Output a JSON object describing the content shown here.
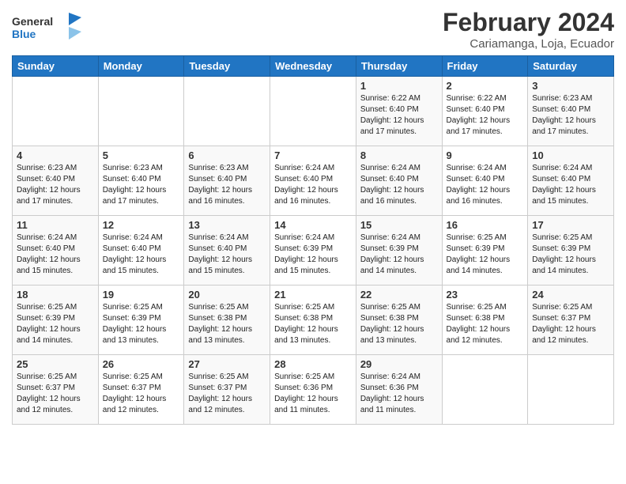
{
  "header": {
    "logo_general": "General",
    "logo_blue": "Blue",
    "title": "February 2024",
    "location": "Cariamanga, Loja, Ecuador"
  },
  "days_of_week": [
    "Sunday",
    "Monday",
    "Tuesday",
    "Wednesday",
    "Thursday",
    "Friday",
    "Saturday"
  ],
  "weeks": [
    [
      {
        "day": "",
        "info": ""
      },
      {
        "day": "",
        "info": ""
      },
      {
        "day": "",
        "info": ""
      },
      {
        "day": "",
        "info": ""
      },
      {
        "day": "1",
        "info": "Sunrise: 6:22 AM\nSunset: 6:40 PM\nDaylight: 12 hours\nand 17 minutes."
      },
      {
        "day": "2",
        "info": "Sunrise: 6:22 AM\nSunset: 6:40 PM\nDaylight: 12 hours\nand 17 minutes."
      },
      {
        "day": "3",
        "info": "Sunrise: 6:23 AM\nSunset: 6:40 PM\nDaylight: 12 hours\nand 17 minutes."
      }
    ],
    [
      {
        "day": "4",
        "info": "Sunrise: 6:23 AM\nSunset: 6:40 PM\nDaylight: 12 hours\nand 17 minutes."
      },
      {
        "day": "5",
        "info": "Sunrise: 6:23 AM\nSunset: 6:40 PM\nDaylight: 12 hours\nand 17 minutes."
      },
      {
        "day": "6",
        "info": "Sunrise: 6:23 AM\nSunset: 6:40 PM\nDaylight: 12 hours\nand 16 minutes."
      },
      {
        "day": "7",
        "info": "Sunrise: 6:24 AM\nSunset: 6:40 PM\nDaylight: 12 hours\nand 16 minutes."
      },
      {
        "day": "8",
        "info": "Sunrise: 6:24 AM\nSunset: 6:40 PM\nDaylight: 12 hours\nand 16 minutes."
      },
      {
        "day": "9",
        "info": "Sunrise: 6:24 AM\nSunset: 6:40 PM\nDaylight: 12 hours\nand 16 minutes."
      },
      {
        "day": "10",
        "info": "Sunrise: 6:24 AM\nSunset: 6:40 PM\nDaylight: 12 hours\nand 15 minutes."
      }
    ],
    [
      {
        "day": "11",
        "info": "Sunrise: 6:24 AM\nSunset: 6:40 PM\nDaylight: 12 hours\nand 15 minutes."
      },
      {
        "day": "12",
        "info": "Sunrise: 6:24 AM\nSunset: 6:40 PM\nDaylight: 12 hours\nand 15 minutes."
      },
      {
        "day": "13",
        "info": "Sunrise: 6:24 AM\nSunset: 6:40 PM\nDaylight: 12 hours\nand 15 minutes."
      },
      {
        "day": "14",
        "info": "Sunrise: 6:24 AM\nSunset: 6:39 PM\nDaylight: 12 hours\nand 15 minutes."
      },
      {
        "day": "15",
        "info": "Sunrise: 6:24 AM\nSunset: 6:39 PM\nDaylight: 12 hours\nand 14 minutes."
      },
      {
        "day": "16",
        "info": "Sunrise: 6:25 AM\nSunset: 6:39 PM\nDaylight: 12 hours\nand 14 minutes."
      },
      {
        "day": "17",
        "info": "Sunrise: 6:25 AM\nSunset: 6:39 PM\nDaylight: 12 hours\nand 14 minutes."
      }
    ],
    [
      {
        "day": "18",
        "info": "Sunrise: 6:25 AM\nSunset: 6:39 PM\nDaylight: 12 hours\nand 14 minutes."
      },
      {
        "day": "19",
        "info": "Sunrise: 6:25 AM\nSunset: 6:39 PM\nDaylight: 12 hours\nand 13 minutes."
      },
      {
        "day": "20",
        "info": "Sunrise: 6:25 AM\nSunset: 6:38 PM\nDaylight: 12 hours\nand 13 minutes."
      },
      {
        "day": "21",
        "info": "Sunrise: 6:25 AM\nSunset: 6:38 PM\nDaylight: 12 hours\nand 13 minutes."
      },
      {
        "day": "22",
        "info": "Sunrise: 6:25 AM\nSunset: 6:38 PM\nDaylight: 12 hours\nand 13 minutes."
      },
      {
        "day": "23",
        "info": "Sunrise: 6:25 AM\nSunset: 6:38 PM\nDaylight: 12 hours\nand 12 minutes."
      },
      {
        "day": "24",
        "info": "Sunrise: 6:25 AM\nSunset: 6:37 PM\nDaylight: 12 hours\nand 12 minutes."
      }
    ],
    [
      {
        "day": "25",
        "info": "Sunrise: 6:25 AM\nSunset: 6:37 PM\nDaylight: 12 hours\nand 12 minutes."
      },
      {
        "day": "26",
        "info": "Sunrise: 6:25 AM\nSunset: 6:37 PM\nDaylight: 12 hours\nand 12 minutes."
      },
      {
        "day": "27",
        "info": "Sunrise: 6:25 AM\nSunset: 6:37 PM\nDaylight: 12 hours\nand 12 minutes."
      },
      {
        "day": "28",
        "info": "Sunrise: 6:25 AM\nSunset: 6:36 PM\nDaylight: 12 hours\nand 11 minutes."
      },
      {
        "day": "29",
        "info": "Sunrise: 6:24 AM\nSunset: 6:36 PM\nDaylight: 12 hours\nand 11 minutes."
      },
      {
        "day": "",
        "info": ""
      },
      {
        "day": "",
        "info": ""
      }
    ]
  ]
}
